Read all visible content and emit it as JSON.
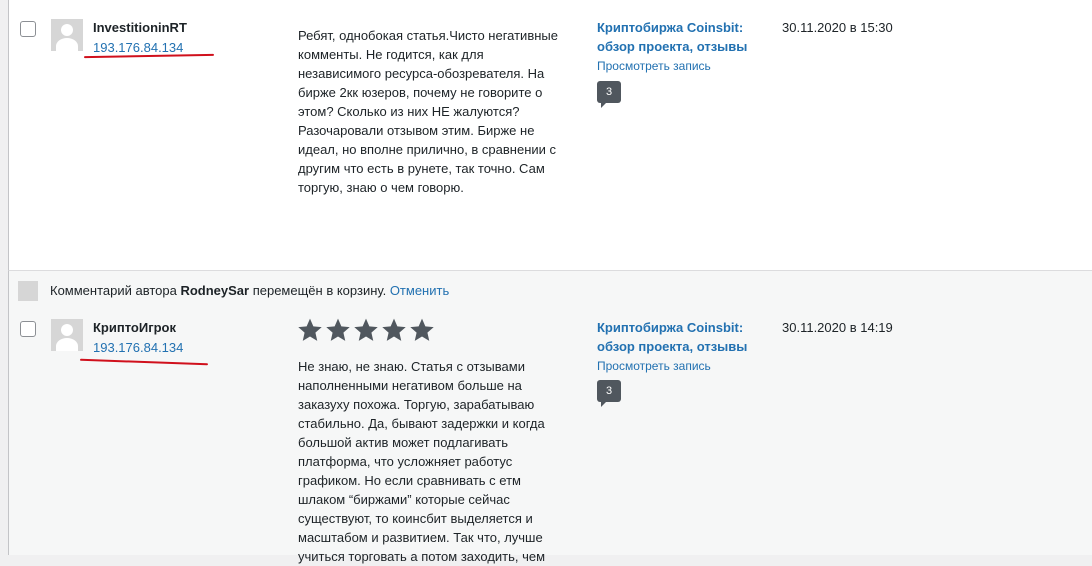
{
  "comments": [
    {
      "author": "InvestitioninRT",
      "ip": "193.176.84.134",
      "text": "Ребят, однобокая статья.Чисто негативные\nкомменты. Не годится, как для\nнезависимого ресурса-обозревателя. На\nбирже 2кк юзеров, почему не говорите о\nэтом? Сколько из них НЕ жалуются?\nРазочаровали отзывом этим. Бирже не\nидеал, но вполне прилично, в сравнении с\nдругим что есть в рунете, так точно. Сам\nторгую, знаю о чем говорю.",
      "post_title": "Криптобиржа Coinsbit:\nобзор проекта, отзывы",
      "view_link": "Просмотреть запись",
      "comment_count": "3",
      "date": "30.11.2020 в 15:30"
    },
    {
      "author": "КриптоИгрок",
      "ip": "193.176.84.134",
      "rating": 5,
      "text": "Не знаю, не знаю. Статья с отзывами\nнаполненными негативом больше на\nзаказуху похожа. Торгую, зарабатываю\nстабильно. Да, бывают задержки и когда\nбольшой актив может подлагивать\nплатформа, что усложняет работус\nграфиком. Но если сравнивать с етм\nшлаком “биржами” которые сейчас\nсуществуют, то коинсбит выделяется и\nмасштабом и развитием. Так что, лучше\nучиться торговать а потом заходить, чем",
      "post_title": "Криптобиржа Coinsbit:\nобзор проекта, отзывы",
      "view_link": "Просмотреть запись",
      "comment_count": "3",
      "date": "30.11.2020 в 14:19"
    }
  ],
  "trash_notice": {
    "prefix": "Комментарий автора ",
    "author": "RodneySar",
    "suffix": " перемещён в корзину. ",
    "undo_label": "Отменить"
  },
  "colors": {
    "link": "#2271b1",
    "annotation_underline": "#d0101c",
    "star": "#50575e"
  }
}
